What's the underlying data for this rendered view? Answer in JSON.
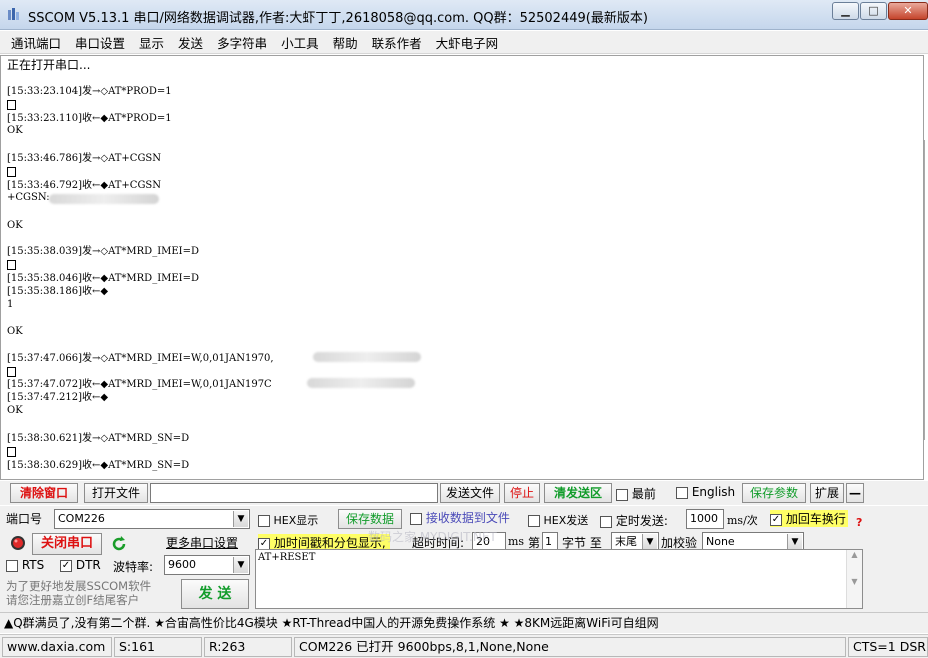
{
  "window": {
    "title": "SSCOM V5.13.1 串口/网络数据调试器,作者:大虾丁丁,2618058@qq.com. QQ群：52502449(最新版本)",
    "min_label": "▁",
    "max_label": "□",
    "close_label": "✕"
  },
  "menu": [
    "通讯端口",
    "串口设置",
    "显示",
    "发送",
    "多字符串",
    "小工具",
    "帮助",
    "联系作者",
    "大虾电子网"
  ],
  "log": {
    "lines": [
      {
        "time": "",
        "text": "正在打开串口..."
      },
      {
        "time": "[15:33:23.104]",
        "dir": "发→◇",
        "text": "AT*PROD=1"
      },
      {
        "time": "[15:33:23.110]",
        "dir": "收←◆",
        "text": "AT*PROD=1"
      },
      {
        "time": "",
        "text": "OK"
      },
      {
        "time": "[15:33:46.786]",
        "dir": "发→◇",
        "text": "AT+CGSN"
      },
      {
        "time": "[15:33:46.792]",
        "dir": "收←◆",
        "text": "AT+CGSN"
      },
      {
        "time": "",
        "text": "+CGSN:"
      },
      {
        "time": "",
        "text": "OK"
      },
      {
        "time": "[15:35:38.039]",
        "dir": "发→◇",
        "text": "AT*MRD_IMEI=D"
      },
      {
        "time": "[15:35:38.046]",
        "dir": "收←◆",
        "text": "AT*MRD_IMEI=D"
      },
      {
        "time": "[15:35:38.186]",
        "dir": "收←◆",
        "text": ""
      },
      {
        "time": "",
        "text": "1"
      },
      {
        "time": "",
        "text": "OK"
      },
      {
        "time": "[15:37:47.066]",
        "dir": "发→◇",
        "text": "AT*MRD_IMEI=W,0,01JAN1970,"
      },
      {
        "time": "[15:37:47.072]",
        "dir": "收←◆",
        "text": "AT*MRD_IMEI=W,0,01JAN197C"
      },
      {
        "time": "[15:37:47.212]",
        "dir": "收←◆",
        "text": ""
      },
      {
        "time": "",
        "text": "OK"
      },
      {
        "time": "[15:38:30.621]",
        "dir": "发→◇",
        "text": "AT*MRD_SN=D"
      },
      {
        "time": "[15:38:30.629]",
        "dir": "收←◆",
        "text": "AT*MRD_SN=D"
      }
    ]
  },
  "toolbar": {
    "clear_window": "清除窗口",
    "open_file": "打开文件",
    "file_path": "",
    "send_file": "发送文件",
    "stop": "停止",
    "clear_send": "清发送区",
    "topmost": "最前",
    "english": "English",
    "save_params": "保存参数",
    "expand": "扩展",
    "collapse": "—"
  },
  "port": {
    "port_label": "端口号",
    "port_value": "COM226",
    "close_port": "关闭串口",
    "more_settings": "更多串口设置",
    "rts": "RTS",
    "dtr": "DTR",
    "baud_label": "波特率:",
    "baud_value": "9600",
    "promo": "为了更好地发展SSCOM软件\n请您注册嘉立创F结尾客户",
    "send": "发 送"
  },
  "options": {
    "hex_display": "HEX显示",
    "save_data": "保存数据",
    "recv_to_file": "接收数据到文件",
    "hex_send": "HEX发送",
    "timed_send": "定时发送:",
    "interval_value": "1000",
    "interval_unit": "ms/次",
    "add_crlf": "加回车换行",
    "timestamp": "加时间戳和分包显示,",
    "timeout_label": "超时时间:",
    "timeout_value": "20",
    "timeout_unit": "ms",
    "byte_prefix": "第",
    "byte_value": "1",
    "byte_label": "字节 至",
    "end_value": "末尾",
    "checksum_label": "加校验",
    "checksum_value": "None",
    "help_mark": "?"
  },
  "send_text": "AT+RESET",
  "watermark": "数码之家 MYDIGIT.NET",
  "marquee": "▲Q群满员了,没有第二个群. ★合宙高性价比4G模块 ★RT-Thread中国人的开源免费操作系统 ★ ★8KM远距离WiFi可自组网",
  "status": {
    "site": "www.daxia.com",
    "sent": "S:161",
    "recv": "R:263",
    "port_state": "COM226 已打开  9600bps,8,1,None,None",
    "cts": "CTS=1 DSR"
  },
  "colors": {
    "accent_red": "#d11111",
    "accent_green": "#119c2a",
    "highlight_yellow": "#ffff66",
    "title_bar": "#c5d6ec"
  }
}
